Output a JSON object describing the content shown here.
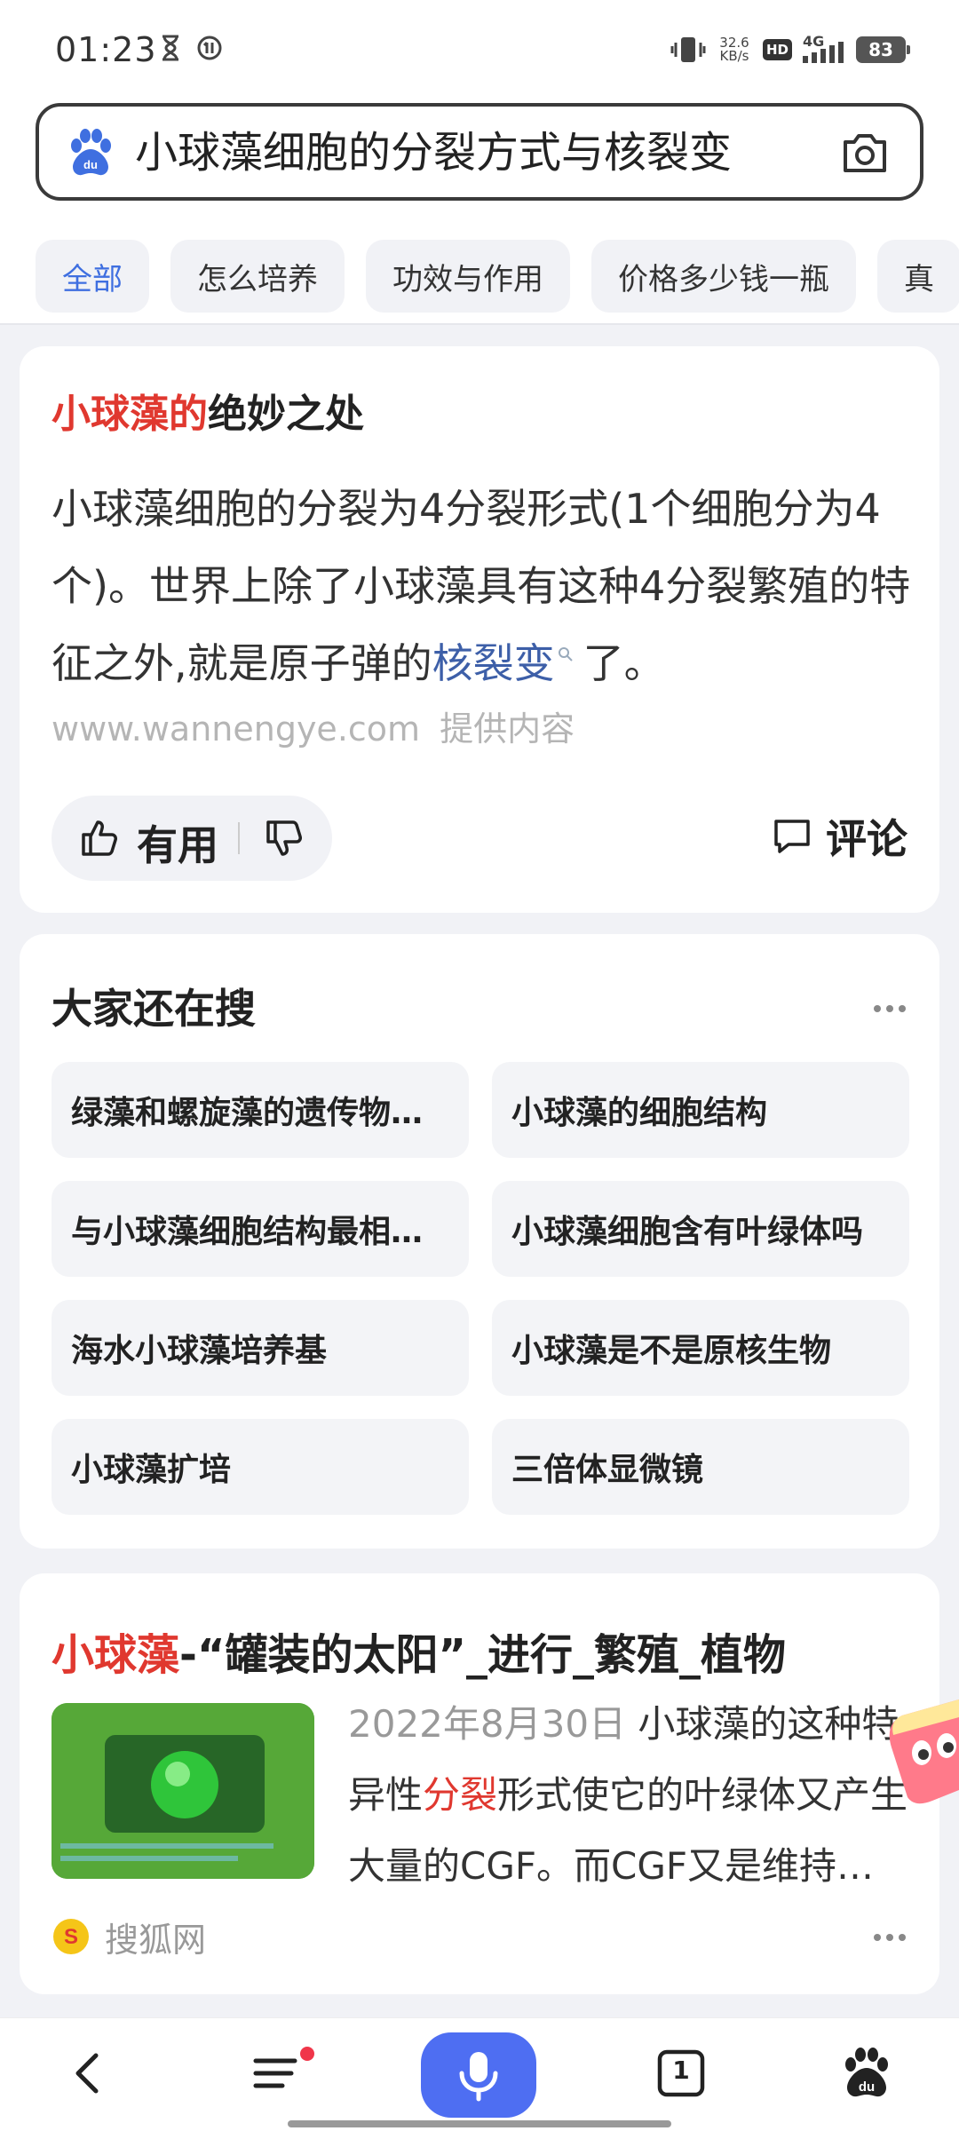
{
  "status_bar": {
    "time": "01:23",
    "net_speed_value": "32.6",
    "net_speed_unit": "KB/s",
    "hd_label": "HD",
    "network_label": "4G",
    "battery": "83"
  },
  "search": {
    "query": "小球藻细胞的分裂方式与核裂变"
  },
  "tabs": [
    "全部",
    "怎么培养",
    "功效与作用",
    "价格多少钱一瓶",
    "真"
  ],
  "answer_card": {
    "title_highlight": "小球藻的",
    "title_rest": "绝妙之处",
    "body_before_link": "小球藻细胞的分裂为4分裂形式(1个细胞分为4个)。世界上除了小球藻具有这种4分裂繁殖的特征之外,就是原子弹的",
    "body_link": "核裂变",
    "body_after_link": "了。",
    "source_domain": "www.wannengye.com",
    "source_suffix": "提供内容",
    "useful_label": "有用",
    "comment_label": "评论"
  },
  "related": {
    "title": "大家还在搜",
    "chips": [
      "绿藻和螺旋藻的遗传物…",
      "小球藻的细胞结构",
      "与小球藻细胞结构最相…",
      "小球藻细胞含有叶绿体吗",
      "海水小球藻培养基",
      "小球藻是不是原核生物",
      "小球藻扩培",
      "三倍体显微镜"
    ]
  },
  "result": {
    "title_highlight": "小球藻",
    "title_rest": "-“罐装的太阳”_进行_繁殖_植物",
    "date": "2022年8月30日",
    "snippet_1": "小球藻的这种特异性",
    "snippet_highlight": "分裂",
    "snippet_2": "形式使它的叶绿体又产生大量的CGF。而CGF又是维持…",
    "source": "搜狐网"
  },
  "bottom_nav": {
    "tab_count": "1"
  },
  "colors": {
    "accent": "#4e6ef2",
    "highlight_red": "#e0382f",
    "link_blue": "#3d5fa8"
  }
}
